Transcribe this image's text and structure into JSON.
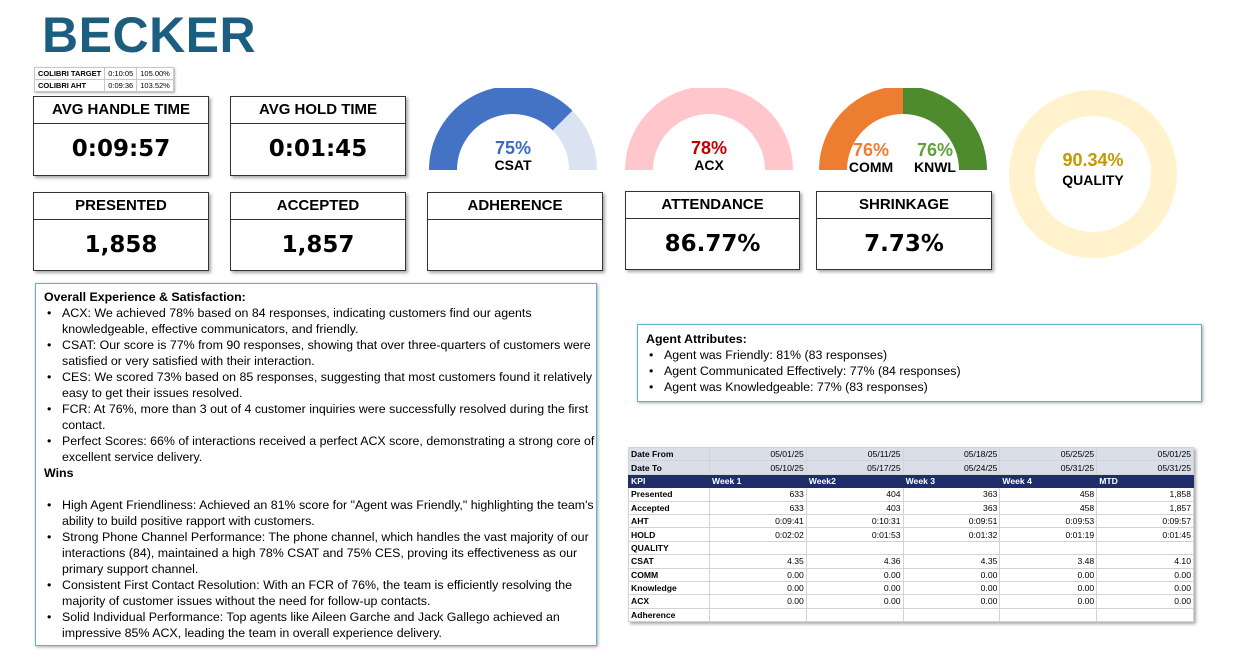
{
  "brand": "BECKER",
  "colibri": {
    "rows": [
      {
        "label": "COLIBRI TARGET",
        "time": "0:10:05",
        "pct": "105.00%"
      },
      {
        "label": "COLIBRI AHT",
        "time": "0:09:36",
        "pct": "103.52%"
      }
    ]
  },
  "cards": {
    "avg_handle_time": {
      "label": "AVG HANDLE TIME",
      "value": "0:09:57"
    },
    "avg_hold_time": {
      "label": "AVG HOLD TIME",
      "value": "0:01:45"
    },
    "presented": {
      "label": "PRESENTED",
      "value": "1,858"
    },
    "accepted": {
      "label": "ACCEPTED",
      "value": "1,857"
    },
    "adherence": {
      "label": "ADHERENCE",
      "value": ""
    },
    "attendance": {
      "label": "ATTENDANCE",
      "value": "86.77%"
    },
    "shrinkage": {
      "label": "SHRINKAGE",
      "value": "7.73%"
    }
  },
  "gauges": {
    "csat": {
      "pct": "75%",
      "label": "CSAT",
      "fraction": 0.75,
      "color": "#4472c4",
      "track": "#dbe3f3",
      "pct_color": "#3b6bc0"
    },
    "acx": {
      "pct": "78%",
      "label": "ACX",
      "fraction": 1.0,
      "color": "#ffc7cb",
      "track": "#ffc7cb",
      "pct_color": "#c00000"
    },
    "comm": {
      "pct": "76%",
      "label": "COMM",
      "fraction": 0.5,
      "color": "#ed7d31",
      "pct_color": "#ed7d31"
    },
    "knwl": {
      "pct": "76%",
      "label": "KNWL",
      "fraction": 0.5,
      "color": "#4e8a2e",
      "pct_color": "#5fa03a"
    },
    "quality": {
      "pct": "90.34%",
      "label": "QUALITY",
      "fraction": 1.0,
      "color": "#fff2cc",
      "pct_color": "#c49a00"
    }
  },
  "overall": {
    "heading": "Overall Experience & Satisfaction:",
    "bullets": [
      "ACX: We achieved 78% based on 84 responses, indicating customers find our agents knowledgeable, effective communicators, and friendly.",
      "CSAT: Our score is 77% from 90 responses, showing that over three-quarters of customers were satisfied or very satisfied with their interaction.",
      "CES: We scored 73% based on 85 responses, suggesting that most customers found it relatively easy to get their issues resolved.",
      "FCR: At 76%, more than 3 out of 4 customer inquiries were successfully resolved during the first contact.",
      "Perfect Scores: 66% of interactions received a perfect ACX score, demonstrating a strong core of excellent service delivery."
    ],
    "wins_heading": "Wins",
    "wins": [
      "High Agent Friendliness: Achieved an 81% score for \"Agent was Friendly,\" highlighting the team's ability to build positive rapport with customers.",
      "Strong Phone Channel Performance: The phone channel, which handles the vast majority of our interactions (84), maintained a high 78% CSAT and 75% CES, proving its effectiveness as our primary support channel.",
      "Consistent First Contact Resolution: With an FCR of 76%, the team is efficiently resolving the majority of customer issues without the need for follow-up contacts.",
      "Solid Individual Performance: Top agents like Aileen Garche and Jack Gallego achieved an impressive 85% ACX, leading the team in overall experience delivery."
    ]
  },
  "agent": {
    "heading": "Agent Attributes:",
    "bullets": [
      "Agent was Friendly: 81% (83 responses)",
      "Agent Communicated Effectively: 77% (84 responses)",
      "Agent was Knowledgeable: 77% (83 responses)"
    ]
  },
  "table": {
    "date_from_label": "Date From",
    "date_to_label": "Date To",
    "date_from": [
      "05/01/25",
      "05/11/25",
      "05/18/25",
      "05/25/25",
      "05/01/25"
    ],
    "date_to": [
      "05/10/25",
      "05/17/25",
      "05/24/25",
      "05/31/25",
      "05/31/25"
    ],
    "header": [
      "KPI",
      "Week 1",
      "Week2",
      "Week 3",
      "Week 4",
      "MTD"
    ],
    "rows": [
      {
        "label": "Presented",
        "cells": [
          "633",
          "404",
          "363",
          "458",
          "1,858"
        ]
      },
      {
        "label": "Accepted",
        "cells": [
          "633",
          "403",
          "363",
          "458",
          "1,857"
        ]
      },
      {
        "label": "AHT",
        "cells": [
          "0:09:41",
          "0:10:31",
          "0:09:51",
          "0:09:53",
          "0:09:57"
        ]
      },
      {
        "label": "HOLD",
        "cells": [
          "0:02:02",
          "0:01:53",
          "0:01:32",
          "0:01:19",
          "0:01:45"
        ]
      },
      {
        "label": "QUALITY",
        "cells": [
          "",
          "",
          "",
          "",
          ""
        ]
      },
      {
        "label": "CSAT",
        "cells": [
          "4.35",
          "4.36",
          "4.35",
          "3.48",
          "4.10"
        ]
      },
      {
        "label": "COMM",
        "cells": [
          "0.00",
          "0.00",
          "0.00",
          "0.00",
          "0.00"
        ]
      },
      {
        "label": "Knowledge",
        "cells": [
          "0.00",
          "0.00",
          "0.00",
          "0.00",
          "0.00"
        ]
      },
      {
        "label": "ACX",
        "cells": [
          "0.00",
          "0.00",
          "0.00",
          "0.00",
          "0.00"
        ]
      },
      {
        "label": "Adherence",
        "cells": [
          "",
          "",
          "",
          "",
          ""
        ]
      }
    ]
  }
}
